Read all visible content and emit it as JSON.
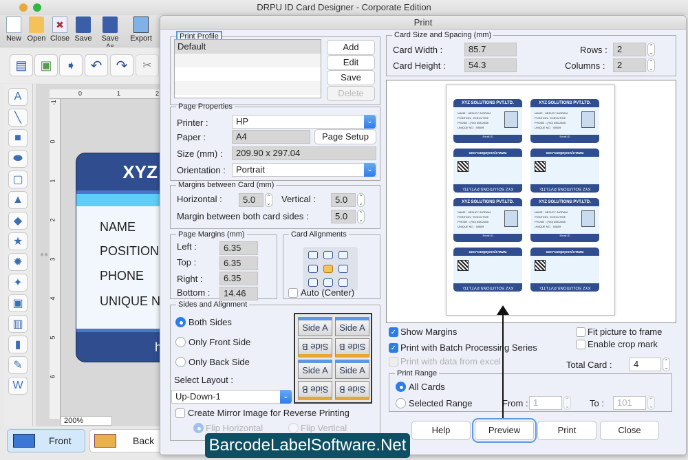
{
  "app": {
    "title": "DRPU ID Card Designer - Corporate Edition",
    "toolbar": [
      {
        "label": "New",
        "icon": "new-document-icon"
      },
      {
        "label": "Open",
        "icon": "open-folder-icon"
      },
      {
        "label": "Close",
        "icon": "close-document-icon"
      },
      {
        "label": "Save",
        "icon": "save-icon"
      },
      {
        "label": "Save As",
        "icon": "save-as-icon"
      },
      {
        "label": "Export",
        "icon": "export-icon"
      }
    ],
    "toolbar2_icons": [
      "properties-icon",
      "image-icon",
      "export-image-icon",
      "undo-icon",
      "redo-icon",
      "cut-icon"
    ],
    "tools": [
      "text-icon",
      "line-icon",
      "rectangle-icon",
      "ellipse-icon",
      "rounded-rectangle-icon",
      "triangle-icon",
      "diamond-icon",
      "star-icon",
      "burst-icon",
      "star4-icon",
      "picture-icon",
      "library-icon",
      "barcode-icon",
      "signature-icon",
      "watermark-icon"
    ],
    "ruler_h": [
      "0",
      "1",
      "2"
    ],
    "ruler_v": [
      "-1",
      "0",
      "1",
      "2",
      "3",
      "4",
      "5",
      "6"
    ],
    "card": {
      "title": "XYZ",
      "fields": [
        "NAME",
        "POSITION",
        "PHONE",
        "UNIQUE N"
      ],
      "footer_partial": "h"
    },
    "zoom": "200%",
    "front_label": "Front",
    "back_label": "Back"
  },
  "dialog": {
    "title": "Print",
    "print_profile": {
      "legend": "Print Profile",
      "items": [
        "Default",
        "",
        "",
        "",
        ""
      ],
      "add": "Add",
      "edit": "Edit",
      "save": "Save",
      "delete": "Delete"
    },
    "page_properties": {
      "legend": "Page Properties",
      "printer_label": "Printer :",
      "printer": "HP",
      "paper_label": "Paper :",
      "paper": "A4",
      "page_setup": "Page Setup",
      "size_label": "Size (mm) :",
      "size": "209.90 x 297.04",
      "orientation_label": "Orientation :",
      "orientation": "Portrait"
    },
    "margins_between": {
      "legend": "Margins between Card (mm)",
      "horizontal_label": "Horizontal :",
      "horizontal": "5.0",
      "vertical_label": "Vertical :",
      "vertical": "5.0",
      "both_sides_label": "Margin between both card sides :",
      "both_sides": "5.0"
    },
    "page_margins": {
      "legend": "Page Margins (mm)",
      "left_label": "Left :",
      "left": "6.35",
      "top_label": "Top :",
      "top": "6.35",
      "right_label": "Right :",
      "right": "6.35",
      "bottom_label": "Bottom :",
      "bottom": "14.46"
    },
    "card_alignments": {
      "legend": "Card Alignments",
      "selected": "middle-center",
      "auto_center": "Auto (Center)",
      "auto_center_checked": false
    },
    "sides": {
      "legend": "Sides and Alignment",
      "options": [
        "Both Sides",
        "Only Front Side",
        "Only Back Side"
      ],
      "selected": "Both Sides",
      "layout_label": "Select Layout :",
      "layout": "Up-Down-1",
      "side_a": "Side A",
      "side_b": "Side B",
      "mirror": "Create Mirror Image for Reverse Printing",
      "mirror_checked": false,
      "flip_h": "Flip Horizontal",
      "flip_v": "Flip Vertical"
    },
    "card_size": {
      "legend": "Card Size and Spacing (mm)",
      "width_label": "Card Width :",
      "width": "85.7",
      "height_label": "Card Height :",
      "height": "54.3",
      "rows_label": "Rows :",
      "rows": "2",
      "columns_label": "Columns :",
      "columns": "2"
    },
    "preview_cards": {
      "company": "XYZ SOLUTIONS PVT.LTD.",
      "name": "NAME : HEDLEY INGRAM",
      "position": "POSITION : EXECUTIVE",
      "phone": "PHONE : (750) 558-2665",
      "unique": "UNIQUE NO. : 08609",
      "email": "Email ID",
      "website": "www.xyzsolutions.com"
    },
    "options": {
      "show_margins": "Show Margins",
      "show_margins_checked": true,
      "batch": "Print with Batch Processing Series",
      "batch_checked": true,
      "excel": "Print with data from excel",
      "fit": "Fit picture to frame",
      "crop": "Enable crop mark",
      "total_label": "Total Card :",
      "total": "4"
    },
    "print_range": {
      "legend": "Print Range",
      "all": "All Cards",
      "selected": "Selected Range",
      "from_label": "From :",
      "from": "1",
      "to_label": "To :",
      "to": "101"
    },
    "buttons": {
      "help": "Help",
      "preview": "Preview",
      "print": "Print",
      "close": "Close"
    }
  },
  "watermark": "BarcodeLabelSoftware.Net"
}
